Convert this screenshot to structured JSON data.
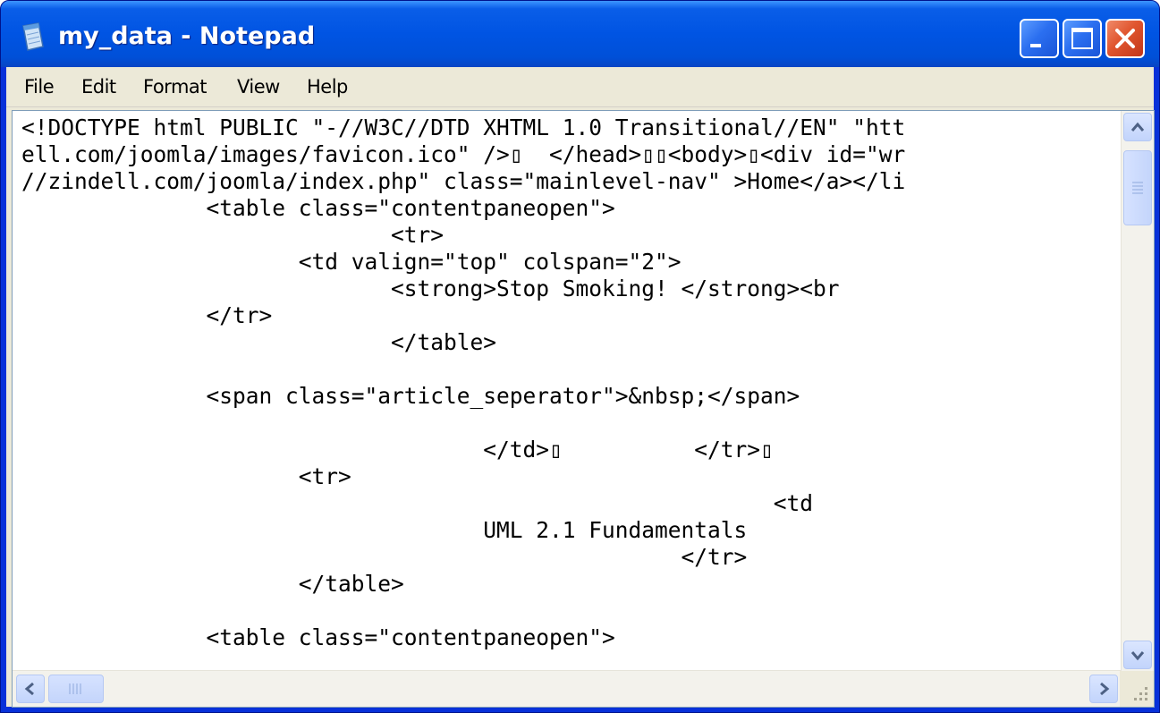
{
  "window": {
    "title": "my_data - Notepad",
    "icon": "notepad-icon",
    "controls": [
      "minimize-icon",
      "maximize-icon",
      "close-icon"
    ]
  },
  "menu": [
    "File",
    "Edit",
    "Format",
    "View",
    "Help"
  ],
  "editor": {
    "lines": [
      "<!DOCTYPE html PUBLIC \"-//W3C//DTD XHTML 1.0 Transitional//EN\" \"htt",
      "ell.com/joomla/images/favicon.ico\" />▯  </head>▯▯<body>▯<div id=\"wr",
      "//zindell.com/joomla/index.php\" class=\"mainlevel-nav\" >Home</a></li",
      "              <table class=\"contentpaneopen\">",
      "                            <tr>",
      "                     <td valign=\"top\" colspan=\"2\">",
      "                            <strong>Stop Smoking! </strong><br",
      "              </tr>",
      "                            </table>",
      "",
      "              <span class=\"article_seperator\">&nbsp;</span>",
      "",
      "                                   </td>▯          </tr>▯",
      "                     <tr>",
      "                                                         <td",
      "                                   UML 2.1 Fundamentals",
      "                                                  </tr>",
      "                     </table>",
      "",
      "              <table class=\"contentpaneopen\">"
    ]
  },
  "scrollbars": {
    "vertical": {
      "up": "scroll-up-arrow-icon",
      "down": "scroll-down-arrow-icon",
      "position": 0.0
    },
    "horizontal": {
      "left": "scroll-left-arrow-icon",
      "right": "scroll-right-arrow-icon",
      "position": 0.0
    }
  },
  "colors": {
    "titlebar": "#0054e3",
    "close_button": "#e0552e",
    "menu_background": "#ece9d8",
    "text": "#000000"
  }
}
